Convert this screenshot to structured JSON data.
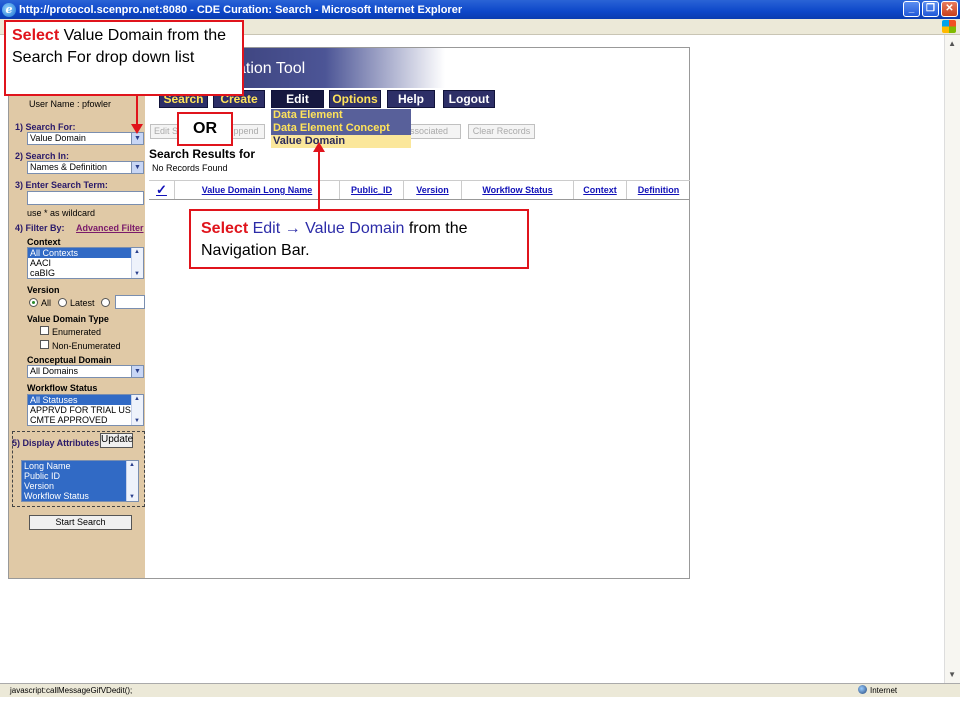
{
  "window": {
    "title": "http://protocol.scenpro.net:8080 - CDE Curation: Search - Microsoft Internet Explorer"
  },
  "app": {
    "banner_title": "ation Tool",
    "nav": [
      "Search",
      "Create",
      "Edit",
      "Options",
      "Help",
      "Logout"
    ],
    "edit_menu": [
      "Data Element",
      "Data Element Concept",
      "Value Domain"
    ],
    "action_buttons": [
      "Edit S",
      "ppend",
      "ssociated",
      "Clear Records"
    ],
    "results_title": "Search Results for",
    "no_records": "No Records Found",
    "columns": [
      "Value Domain Long Name",
      "Public_ID",
      "Version",
      "Workflow Status",
      "Context",
      "Definition"
    ]
  },
  "left_panel": {
    "user_name": "User Name : pfowler",
    "search_for_label": "1) Search For:",
    "search_for_value": "Value Domain",
    "search_in_label": "2) Search In:",
    "search_in_value": "Names & Definition",
    "search_term_label": "3) Enter Search Term:",
    "wildcard_hint": "use * as wildcard",
    "filter_label": "4) Filter By:",
    "advanced_filter": "Advanced Filter",
    "context_label": "Context",
    "contexts": [
      "All Contexts",
      "AACI",
      "caBIG"
    ],
    "version_label": "Version",
    "version_all": "All",
    "version_latest": "Latest",
    "vd_type_label": "Value Domain Type",
    "vd_enumerated": "Enumerated",
    "vd_non_enumerated": "Non-Enumerated",
    "conceptual_domain_label": "Conceptual Domain",
    "conceptual_domain_value": "All Domains",
    "workflow_label": "Workflow Status",
    "workflow_items": [
      "All Statuses",
      "APPRVD FOR TRIAL USE",
      "CMTE APPROVED"
    ],
    "display_attributes_label": "5) Display Attributes:",
    "update_button": "Update",
    "attributes": [
      "Long Name",
      "Public ID",
      "Version",
      "Workflow Status"
    ],
    "start_search": "Start Search"
  },
  "callouts": {
    "first": {
      "select": "Select",
      "rest": " Value Domain from the Search For drop down list"
    },
    "or": "OR",
    "second": {
      "select": "Select",
      "edit": "Edit",
      "arrow": "→",
      "vd": "Value Domain",
      "tail": " from the Navigation Bar."
    }
  },
  "status_bar": {
    "text": "javascript:callMessageGifVDedit();",
    "zone": "Internet"
  }
}
